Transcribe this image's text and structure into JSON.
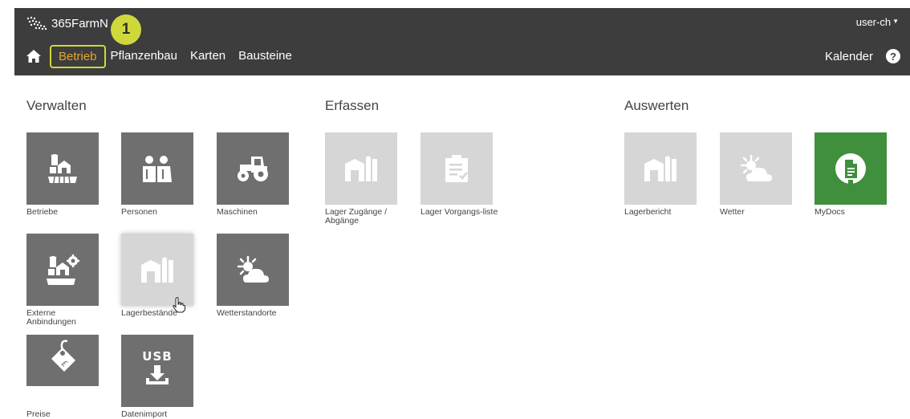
{
  "header": {
    "logo_text": "365FarmN",
    "user_label": "user-ch",
    "callout_number": "1"
  },
  "nav": {
    "items": [
      "Betrieb",
      "Pflanzenbau",
      "Karten",
      "Bausteine"
    ],
    "active": "Betrieb",
    "kalender": "Kalender",
    "help": "?"
  },
  "sections": {
    "verwalten": "Verwalten",
    "erfassen": "Erfassen",
    "auswerten": "Auswerten"
  },
  "tiles": {
    "betriebe": "Betriebe",
    "personen": "Personen",
    "maschinen": "Maschinen",
    "externe": "Externe Anbindungen",
    "lagerbestaende": "Lagerbestände",
    "wetterstandorte": "Wetterstandorte",
    "preise": "Preise",
    "datenimport": "Datenimport",
    "lager_zugaenge": "Lager Zugänge / Abgänge",
    "lager_vorgangsliste": "Lager Vorgangs-liste",
    "lagerbericht": "Lagerbericht",
    "wetter": "Wetter",
    "mydocs": "MyDocs"
  },
  "icons": {
    "logo": "farm-logo-icon",
    "home": "home-icon",
    "caret": "caret-down-icon",
    "betriebe": "farm-buildings-icon",
    "personen": "people-icon",
    "maschinen": "tractor-icon",
    "externe": "farm-settings-icon",
    "lager": "silo-icon",
    "wetter": "sun-cloud-icon",
    "preise": "price-tag-icon",
    "datenimport": "usb-download-icon",
    "vorgangsliste": "clipboard-check-icon",
    "mydocs": "document-icon",
    "cursor": "hand-cursor-icon"
  },
  "colors": {
    "topbar": "#3d3d3d",
    "active_nav": "#e3a72f",
    "highlight": "#cfd83a",
    "tile": "#6f6f6f",
    "tile_disabled": "#d6d6d6",
    "mydocs": "#3f8f3d"
  }
}
